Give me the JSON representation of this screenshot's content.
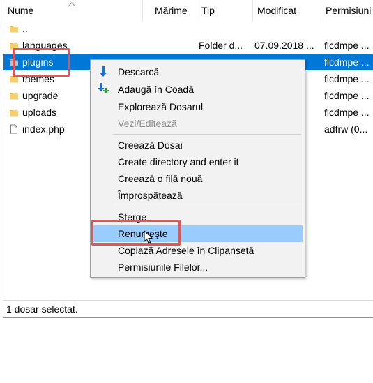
{
  "columns": {
    "name": "Nume",
    "size": "Mărime",
    "type": "Tip",
    "modified": "Modificat",
    "permissions": "Permisiuni"
  },
  "rows": [
    {
      "name": "..",
      "type": "",
      "modified": "",
      "permissions": "",
      "kind": "folder"
    },
    {
      "name": "languages",
      "type": "Folder d...",
      "modified": "07.09.2018 ...",
      "permissions": "flcdmpe ...",
      "kind": "folder"
    },
    {
      "name": "plugins",
      "type": "",
      "modified": "",
      "permissions": "flcdmpe ...",
      "kind": "folder",
      "selected": true
    },
    {
      "name": "themes",
      "type": "",
      "modified": "",
      "permissions": "flcdmpe ...",
      "kind": "folder"
    },
    {
      "name": "upgrade",
      "type": "",
      "modified": "",
      "permissions": "flcdmpe ...",
      "kind": "folder"
    },
    {
      "name": "uploads",
      "type": "",
      "modified": "",
      "permissions": "flcdmpe ...",
      "kind": "folder"
    },
    {
      "name": "index.php",
      "type": "",
      "modified": "",
      "permissions": "adfrw (0...",
      "kind": "file"
    }
  ],
  "status": "1 dosar selectat.",
  "context_menu": {
    "download": "Descarcă",
    "add_to_queue": "Adaugă în Coadă",
    "explore": "Explorează Dosarul",
    "view_edit": "Vezi/Editează",
    "create_dir": "Creează Dosar",
    "create_dir_enter": "Create directory and enter it",
    "create_file": "Creează o filă nouă",
    "refresh": "Împrospătează",
    "delete": "Șterge",
    "rename": "Renumește",
    "copy_url": "Copiază Adresele în Clipanșetă",
    "file_permissions": "Permisiunile Filelor..."
  },
  "colors": {
    "selection": "#0078d7",
    "menu_hover": "#99ccff",
    "highlight": "#e45454",
    "folder": "#e8b84a"
  },
  "icons": {
    "download": "download-arrow-icon",
    "queue": "add-to-queue-icon",
    "folder": "folder-icon",
    "file": "file-icon",
    "cursor": "mouse-cursor-icon"
  }
}
